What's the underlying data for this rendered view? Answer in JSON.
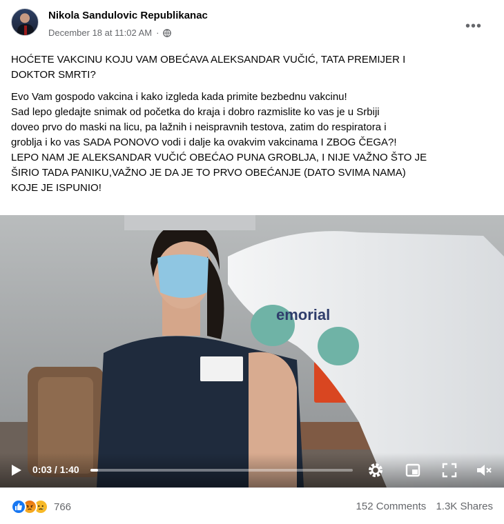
{
  "post": {
    "author": "Nikola Sandulovic Republikanac",
    "timestamp": "December 18 at 11:02 AM",
    "privacy_icon": "globe-icon",
    "more_icon": "more-horizontal-icon",
    "more_label": "•••"
  },
  "text": {
    "headline_lines": [
      "HOĆETE VAKCINU KOJU VAM OBEĆAVA ALEKSANDAR VUČIĆ, TATA PREMIJER I",
      "DOKTOR SMRTI?"
    ],
    "body_lines": [
      "Evo Vam gospodo vakcina i  kako izgleda kada primite bezbednu vakcinu!",
      "Sad lepo gledajte snimak od početka do kraja i dobro razmislite ko vas je u Srbiji",
      "doveo prvo do maski na licu, pa lažnih i neispravnih testova, zatim do respiratora i",
      "groblja i ko vas SADA PONOVO vodi i dalje  ka ovakvim vakcinama I ZBOG ČEGA?!",
      "LEPO NAM JE  ALEKSANDAR VUČIĆ OBEĆAO PUNA GROBLJA, I NIJE VAŽNO ŠTO JE",
      "ŠIRIO TADA PANIKU,VAŽNO JE DA JE TO PRVO OBEĆANJE (DATO SVIMA NAMA)",
      "KOJE JE ISPUNIO!"
    ]
  },
  "video": {
    "time_display": "0:03 / 1:40",
    "progress_fraction": 0.03,
    "background_sign_text": "emorial",
    "controls": [
      "play-icon",
      "settings-icon",
      "picture-in-picture-icon",
      "fullscreen-icon",
      "volume-muted-icon"
    ]
  },
  "footer": {
    "reactions": [
      "like",
      "angry",
      "sad"
    ],
    "reaction_count": "766",
    "comments": "152 Comments",
    "shares": "1.3K Shares"
  },
  "colors": {
    "brand_blue": "#1877f2",
    "secondary_text": "#65676b",
    "primary_text": "#050505"
  }
}
